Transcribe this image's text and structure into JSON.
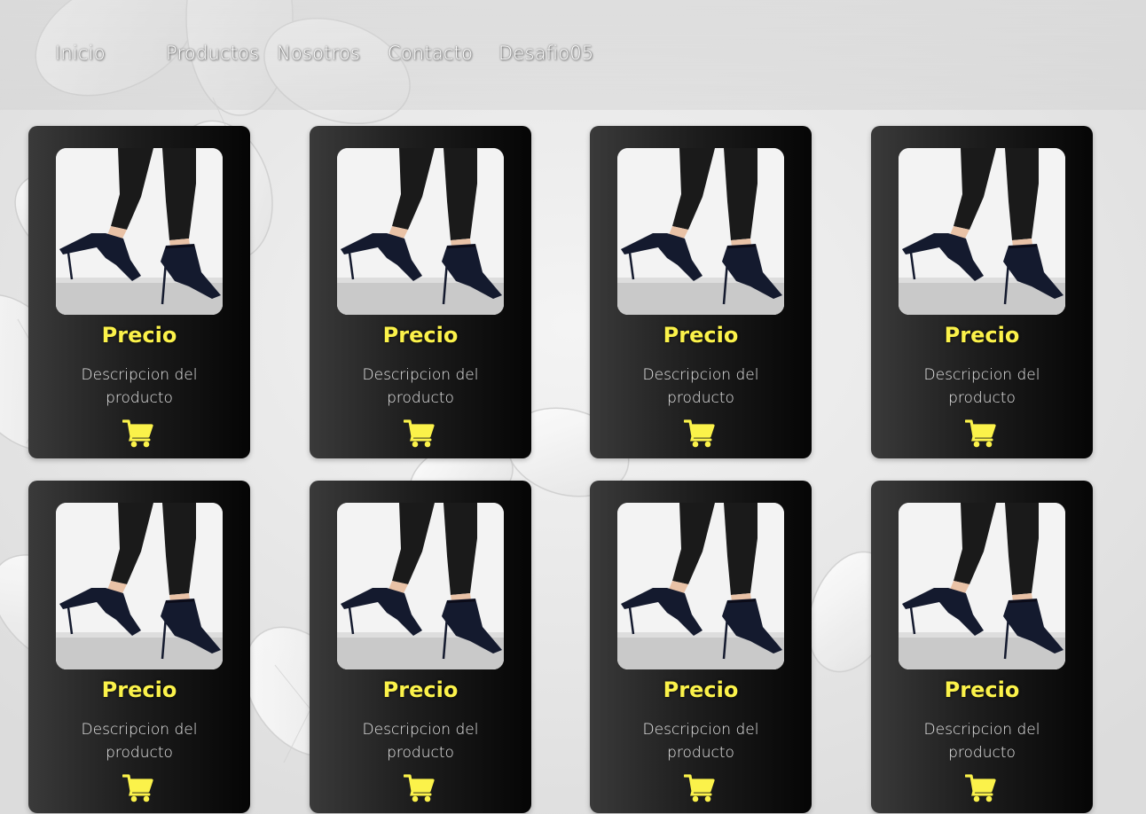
{
  "nav": {
    "items": [
      {
        "label": "Inicio"
      },
      {
        "label": "Productos"
      },
      {
        "label": "Nosotros"
      },
      {
        "label": "Contacto"
      },
      {
        "label": "Desafio05"
      }
    ]
  },
  "products": [
    {
      "price": "Precio",
      "description": "Descripcion del producto"
    },
    {
      "price": "Precio",
      "description": "Descripcion del producto"
    },
    {
      "price": "Precio",
      "description": "Descripcion del producto"
    },
    {
      "price": "Precio",
      "description": "Descripcion del producto"
    },
    {
      "price": "Precio",
      "description": "Descripcion del producto"
    },
    {
      "price": "Precio",
      "description": "Descripcion del producto"
    },
    {
      "price": "Precio",
      "description": "Descripcion del producto"
    },
    {
      "price": "Precio",
      "description": "Descripcion del producto"
    }
  ],
  "icons": {
    "cart": "cart-icon"
  },
  "colors": {
    "accent": "#fbf24a",
    "card_dark": "#050505",
    "card_light": "#3a3a3a"
  }
}
